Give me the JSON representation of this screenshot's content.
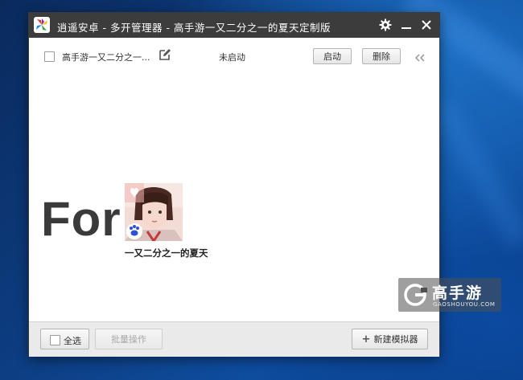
{
  "window": {
    "app_name": "逍遥安卓 - 多开管理器",
    "edition": "- 高手游一又二分之一的夏天定制版",
    "controls": [
      "settings-icon",
      "minimize-icon",
      "close-icon"
    ]
  },
  "instances": [
    {
      "name": "高手游一又二分之一...",
      "status": "未启动",
      "start_label": "启动",
      "delete_label": "删除"
    }
  ],
  "promo": {
    "for_text": "For",
    "game_name": "一又二分之一的夏天"
  },
  "watermark": {
    "brand": "高手游",
    "domain": "GAOSHOUYOU.COM"
  },
  "footer": {
    "select_all_label": "全选",
    "batch_label": "批量操作",
    "new_label": "新建模拟器"
  },
  "colors": {
    "titlebar": "#3c3c3c",
    "footer": "#eaeaea",
    "desktop": "#0d3f85"
  }
}
